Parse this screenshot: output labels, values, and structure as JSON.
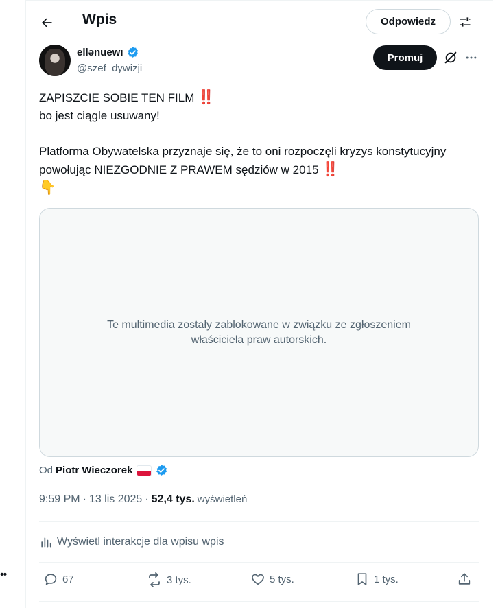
{
  "header": {
    "title": "Wpis",
    "reply_label": "Odpowiedz"
  },
  "author": {
    "display_name": "ellənuewı",
    "handle": "@szef_dywizji",
    "verified": true,
    "verified_color": "#1d9bf0"
  },
  "author_actions": {
    "promote_label": "Promuj"
  },
  "tweet": {
    "lines": [
      "ZAPISZCIE SOBIE TEN FILM",
      "bo jest ciągle usuwany!",
      "",
      "Platforma Obywatelska przyznaje się, że to oni rozpoczęli kryzys konstytucyjny powołując NIEZGODNIE Z PRAWEM sędziów w 2015"
    ],
    "emphasis_emoji": "‼️",
    "pointing_emoji": "👇"
  },
  "media": {
    "blocked_message": "Te multimedia zostały zablokowane w związku ze zgłoszeniem właściciela praw autorskich."
  },
  "attribution": {
    "prefix": "Od",
    "name": "Piotr Wieczorek"
  },
  "meta": {
    "time": "9:59 PM",
    "separator": "·",
    "date": "13 lis 2025",
    "views_count": "52,4 tys.",
    "views_label": "wyświetleń"
  },
  "analytics": {
    "label": "Wyświetl interakcje dla wpisu wpis"
  },
  "actions": {
    "replies": "67",
    "reposts": "3 tys.",
    "likes": "5 tys.",
    "bookmarks": "1 tys."
  },
  "colors": {
    "text_primary": "#0f1419",
    "text_secondary": "#536471",
    "border": "#cfd9de",
    "accent": "#1d9bf0",
    "emphasis_red": "#c4122f"
  }
}
